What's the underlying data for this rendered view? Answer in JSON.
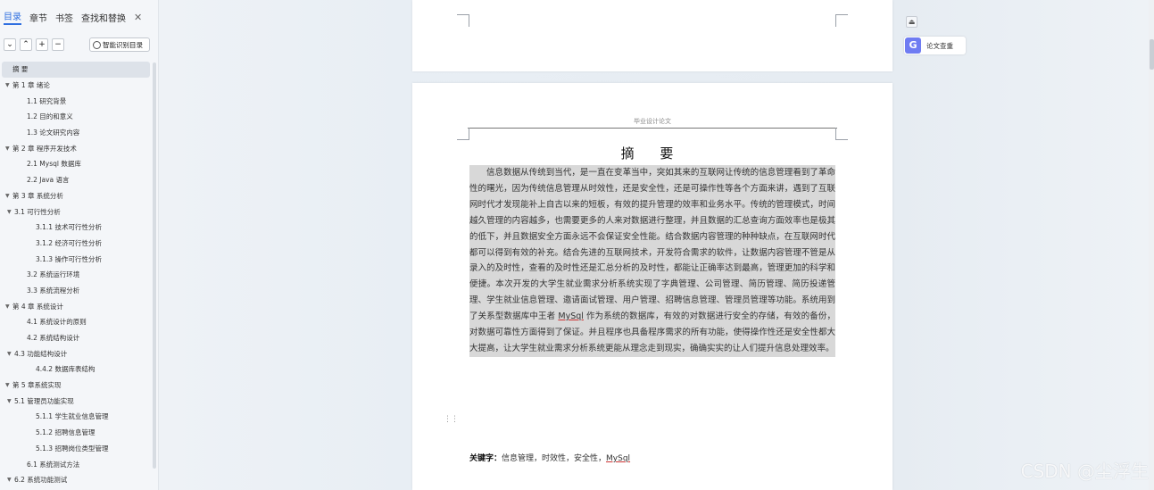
{
  "left_panel": {
    "tabs": [
      "目录",
      "章节",
      "书签",
      "查找和替换"
    ],
    "toolbar": {
      "collapse": "⌄",
      "expand": "⌃",
      "add": "+",
      "remove": "−",
      "smart_label": "智能识别目录"
    },
    "toc": [
      {
        "label": "摘 要",
        "caret": ""
      },
      {
        "label": "第 1 章 绪论",
        "caret": "▼"
      },
      {
        "label": "1.1 研究背景",
        "caret": ""
      },
      {
        "label": "1.2 目的和意义",
        "caret": ""
      },
      {
        "label": "1.3 论文研究内容",
        "caret": ""
      },
      {
        "label": "第 2 章 程序开发技术",
        "caret": "▼"
      },
      {
        "label": "2.1 Mysql 数据库",
        "caret": ""
      },
      {
        "label": "2.2 Java 语言",
        "caret": ""
      },
      {
        "label": "第 3 章 系统分析",
        "caret": "▼"
      },
      {
        "label": "3.1 可行性分析",
        "caret": "▼"
      },
      {
        "label": "3.1.1 技术可行性分析",
        "caret": ""
      },
      {
        "label": "3.1.2 经济可行性分析",
        "caret": ""
      },
      {
        "label": "3.1.3 操作可行性分析",
        "caret": ""
      },
      {
        "label": "3.2 系统运行环境",
        "caret": ""
      },
      {
        "label": "3.3 系统流程分析",
        "caret": ""
      },
      {
        "label": "第 4 章 系统设计",
        "caret": "▼"
      },
      {
        "label": "4.1 系统设计的原则",
        "caret": ""
      },
      {
        "label": "4.2 系统结构设计",
        "caret": ""
      },
      {
        "label": "4.3 功能结构设计",
        "caret": "▼"
      },
      {
        "label": "4.4.2 数据库表结构",
        "caret": ""
      },
      {
        "label": "第 5 章系统实现",
        "caret": "▼"
      },
      {
        "label": "5.1 管理员功能实现",
        "caret": "▼"
      },
      {
        "label": "5.1.1 学生就业信息管理",
        "caret": ""
      },
      {
        "label": "5.1.2 招聘信息管理",
        "caret": ""
      },
      {
        "label": "5.1.3 招聘岗位类型管理",
        "caret": ""
      },
      {
        "label": "6.1 系统测试方法",
        "caret": ""
      },
      {
        "label": "6.2 系统功能测试",
        "caret": "▼"
      }
    ]
  },
  "document": {
    "header": "毕业设计论文",
    "title": "摘 要",
    "abstract_before": "信息数据从传统到当代，是一直在变革当中，突如其来的互联网让传统的信息管理看到了革命性的曙光，因为传统信息管理从时效性，还是安全性，还是可操作性等各个方面来讲，遇到了互联网时代才发现能补上自古以来的短板，有效的提升管理的效率和业务水平。传统的管理模式，时间越久管理的内容越多，也需要更多的人来对数据进行整理，并且数据的汇总查询方面效率也是极其的低下，并且数据安全方面永远不会保证安全性能。结合数据内容管理的种种缺点，在互联网时代都可以得到有效的补充。结合先进的互联网技术，开发符合需求的软件，让数据内容管理不管是从录入的及时性，查看的及时性还是汇总分析的及时性，都能让正确率达到最高，管理更加的科学和便捷。本次开发的大学生就业需求分析系统实现了字典管理、公司管理、简历管理、简历投递管理、学生就业信息管理、邀请面试管理、用户管理、招聘信息管理、管理员管理等功能。系统用到了关系型数据库中王者 ",
    "abstract_mysql": "MySql",
    "abstract_after": " 作为系统的数据库，有效的对数据进行安全的存储，有效的备份，对数据可靠性方面得到了保证。并且程序也具备程序需求的所有功能，使得操作性还是安全性都大大提高，让大学生就业需求分析系统更能从理念走到现实，确确实实的让人们提升信息处理效率。",
    "keywords_label": "关键字：",
    "keywords_text": "信息管理，时效性，安全性，",
    "keywords_mysql": "MySql"
  },
  "right_panel": {
    "essay_icon": "G",
    "essay_label": "论文查重"
  },
  "watermark": "CSDN @尘浮生",
  "colors": {
    "accent": "#2f6fe0",
    "essay_icon_bg": "#6f7cf2",
    "selection": "#d8d8d8"
  }
}
